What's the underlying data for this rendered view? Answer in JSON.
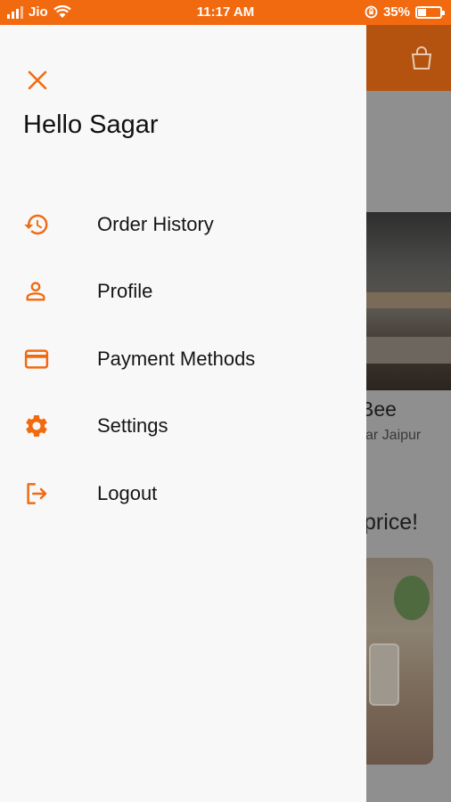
{
  "status_bar": {
    "carrier": "Jio",
    "time": "11:17 AM",
    "battery_percent_label": "35%",
    "battery_level": 0.35
  },
  "colors": {
    "accent": "#f26a10",
    "drawer_background": "#f8f8f8",
    "text": "#151515"
  },
  "drawer": {
    "close_icon": "close-icon",
    "greeting": "Hello Sagar",
    "menu_items": [
      {
        "label": "Order History",
        "icon": "history-icon"
      },
      {
        "label": "Profile",
        "icon": "person-icon"
      },
      {
        "label": "Payment Methods",
        "icon": "credit-card-icon"
      },
      {
        "label": "Settings",
        "icon": "gear-icon"
      },
      {
        "label": "Logout",
        "icon": "logout-icon"
      }
    ]
  },
  "background_page": {
    "cart_icon": "shopping-bag-icon",
    "restaurant_title_fragment": "Bee",
    "restaurant_subtitle_fragment": "ar Jaipur",
    "promo_fragment": "price!"
  }
}
